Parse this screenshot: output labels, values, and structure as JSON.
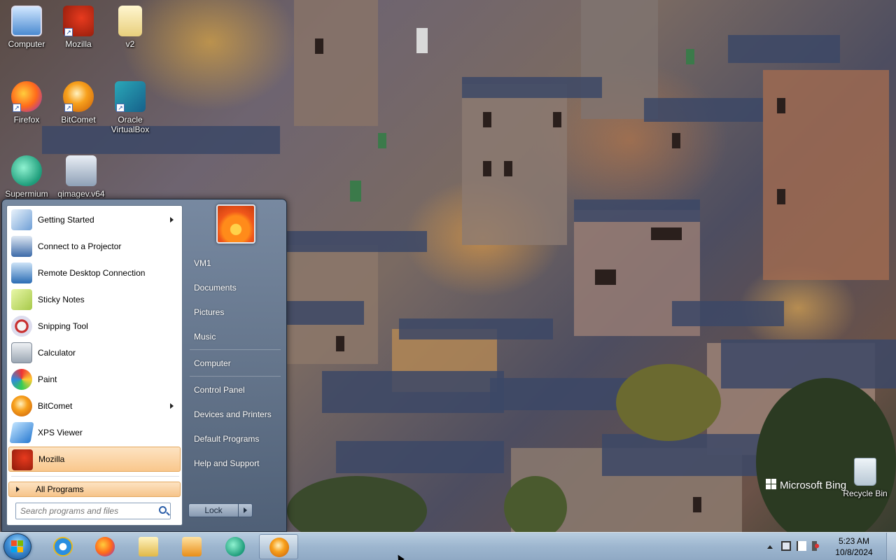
{
  "desktop": {
    "icons": [
      {
        "label": "Computer",
        "icon": "computer-icon"
      },
      {
        "label": "Mozilla",
        "icon": "mozilla-icon"
      },
      {
        "label": "v2",
        "icon": "folder-icon"
      },
      {
        "label": "Firefox",
        "icon": "firefox-icon"
      },
      {
        "label": "BitComet",
        "icon": "bitcomet-icon"
      },
      {
        "label": "Oracle VirtualBox",
        "icon": "virtualbox-icon"
      },
      {
        "label": "Supermium",
        "icon": "supermium-icon"
      },
      {
        "label": "qimagev.v64",
        "icon": "installer-icon"
      }
    ],
    "recycle_bin": {
      "label": "Recycle Bin",
      "icon": "recycle-bin-icon"
    },
    "watermark": "Microsoft Bing"
  },
  "start_menu": {
    "programs": [
      {
        "label": "Getting Started",
        "icon": "getting-started-icon",
        "submenu": true
      },
      {
        "label": "Connect to a Projector",
        "icon": "projector-icon",
        "submenu": false
      },
      {
        "label": "Remote Desktop Connection",
        "icon": "remote-desktop-icon",
        "submenu": false
      },
      {
        "label": "Sticky Notes",
        "icon": "sticky-notes-icon",
        "submenu": false
      },
      {
        "label": "Snipping Tool",
        "icon": "snipping-tool-icon",
        "submenu": false
      },
      {
        "label": "Calculator",
        "icon": "calculator-icon",
        "submenu": false
      },
      {
        "label": "Paint",
        "icon": "paint-icon",
        "submenu": false
      },
      {
        "label": "BitComet",
        "icon": "bitcomet-icon",
        "submenu": true
      },
      {
        "label": "XPS Viewer",
        "icon": "xps-viewer-icon",
        "submenu": false
      },
      {
        "label": "Mozilla",
        "icon": "mozilla-icon",
        "submenu": false,
        "highlighted": true
      }
    ],
    "all_programs": "All Programs",
    "search_placeholder": "Search programs and files",
    "right_items": [
      {
        "label": "VM1"
      },
      {
        "label": "Documents"
      },
      {
        "label": "Pictures"
      },
      {
        "label": "Music"
      },
      {
        "label": "Computer"
      },
      {
        "label": "Control Panel"
      },
      {
        "label": "Devices and Printers"
      },
      {
        "label": "Default Programs"
      },
      {
        "label": "Help and Support"
      }
    ],
    "lock_label": "Lock"
  },
  "taskbar": {
    "pinned": [
      {
        "icon": "internet-explorer-icon"
      },
      {
        "icon": "firefox-icon"
      },
      {
        "icon": "file-explorer-icon"
      },
      {
        "icon": "media-player-icon"
      },
      {
        "icon": "supermium-icon"
      },
      {
        "icon": "bitcomet-icon",
        "active": true
      }
    ],
    "clock": {
      "time": "5:23 AM",
      "date": "10/8/2024"
    }
  },
  "colors": {
    "highlight": "#f9c78c",
    "taskbar": "#9db6cf",
    "menu_glass": "#4e6078"
  }
}
